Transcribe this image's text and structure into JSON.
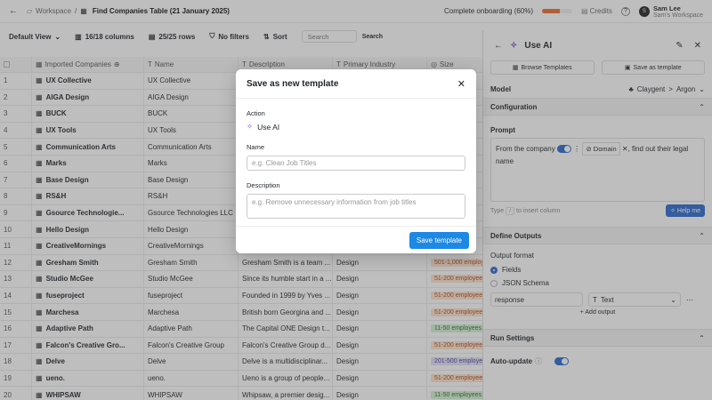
{
  "topbar": {
    "back": "←",
    "workspace": "Workspace",
    "sep": "/",
    "title": "Find Companies Table (21 January 2025)",
    "onboarding": "Complete onboarding (60%)",
    "onboarding_fraction": 0.6,
    "credits": "Credits",
    "help": "?",
    "user_initial": "S",
    "user_name": "Sam Lee",
    "user_workspace": "Sam's Workspace"
  },
  "toolbar": {
    "view": "Default View",
    "columns": "16/18 columns",
    "rows": "25/25 rows",
    "filters": "No filters",
    "sort": "Sort",
    "search_placeholder": "Search",
    "search_btn": "Search"
  },
  "table": {
    "headers": [
      "",
      "Imported Companies",
      "Name",
      "Description",
      "Primary Industry",
      "Size"
    ],
    "rows": [
      [
        "1",
        "UX Collective",
        "UX Collective",
        "",
        "",
        ""
      ],
      [
        "2",
        "AIGA Design",
        "AIGA Design",
        "",
        "",
        ""
      ],
      [
        "3",
        "BUCK",
        "BUCK",
        "",
        "",
        ""
      ],
      [
        "4",
        "UX Tools",
        "UX Tools",
        "",
        "",
        ""
      ],
      [
        "5",
        "Communication Arts",
        "Communication Arts",
        "",
        "",
        ""
      ],
      [
        "6",
        "Marks",
        "Marks",
        "",
        "",
        ""
      ],
      [
        "7",
        "Base Design",
        "Base Design",
        "",
        "",
        ""
      ],
      [
        "8",
        "RS&H",
        "RS&H",
        "",
        "",
        ""
      ],
      [
        "9",
        "Gsource Technologie...",
        "Gsource Technologies LLC",
        "",
        "",
        ""
      ],
      [
        "10",
        "Hello Design",
        "Hello Design",
        "",
        "",
        ""
      ],
      [
        "11",
        "CreativeMornings",
        "CreativeMornings",
        "",
        "",
        ""
      ],
      [
        "12",
        "Gresham Smith",
        "Gresham Smith",
        "Gresham Smith is a team ...",
        "Design",
        "501-1,000 employee"
      ],
      [
        "13",
        "Studio McGee",
        "Studio McGee",
        "Since its humble start in a ...",
        "Design",
        "51-200 employees"
      ],
      [
        "14",
        "fuseproject",
        "fuseproject",
        "Founded in 1999 by Yves ...",
        "Design",
        "51-200 employees"
      ],
      [
        "15",
        "Marchesa",
        "Marchesa",
        "British born Georgina and ...",
        "Design",
        "51-200 employees"
      ],
      [
        "16",
        "Adaptive Path",
        "Adaptive Path",
        "The Capital ONE Design t...",
        "Design",
        "11-50 employees"
      ],
      [
        "17",
        "Falcon's Creative Gro...",
        "Falcon's Creative Group",
        "Falcon's Creative Group d...",
        "Design",
        "51-200 employees"
      ],
      [
        "18",
        "Delve",
        "Delve",
        "Delve is a multidisciplinar...",
        "Design",
        "201-500 employee"
      ],
      [
        "19",
        "ueno.",
        "ueno.",
        "Ueno is a group of people...",
        "Design",
        "51-200 employees"
      ],
      [
        "20",
        "WHIPSAW",
        "WHIPSAW",
        "Whipsaw, a premier desig...",
        "Design",
        "11-50 employees"
      ]
    ]
  },
  "panel": {
    "back": "←",
    "title": "Use AI",
    "edit": "✎",
    "close": "✕",
    "browse_templates": "Browse Templates",
    "save_as_template": "Save as template",
    "model_label": "Model",
    "model_provider": "Claygent",
    "model_sep": ">",
    "model_name": "Argon",
    "configuration": "Configuration",
    "prompt_label": "Prompt",
    "prompt_text1": "From the company",
    "prompt_chip": "Domain",
    "prompt_text2": ", find out their legal name",
    "hint_type": "Type",
    "hint_slash": "/",
    "hint_rest": "to insert column",
    "help_me": "Help me",
    "define_outputs": "Define Outputs",
    "output_format": "Output format",
    "fields": "Fields",
    "json_schema": "JSON Schema",
    "field_name": "response",
    "field_type": "Text",
    "add_output": "+ Add output",
    "run_settings": "Run Settings",
    "auto_update": "Auto-update"
  },
  "modal": {
    "title": "Save as new template",
    "close": "✕",
    "action_label": "Action",
    "action_value": "Use AI",
    "name_label": "Name",
    "name_placeholder": "e.g. Clean Job Titles",
    "desc_label": "Description",
    "desc_placeholder": "e.g. Remove unnecessary information from job titles",
    "save": "Save template"
  },
  "colors": {
    "accent": "#1e88e5",
    "orange": "#ef6a2f"
  }
}
